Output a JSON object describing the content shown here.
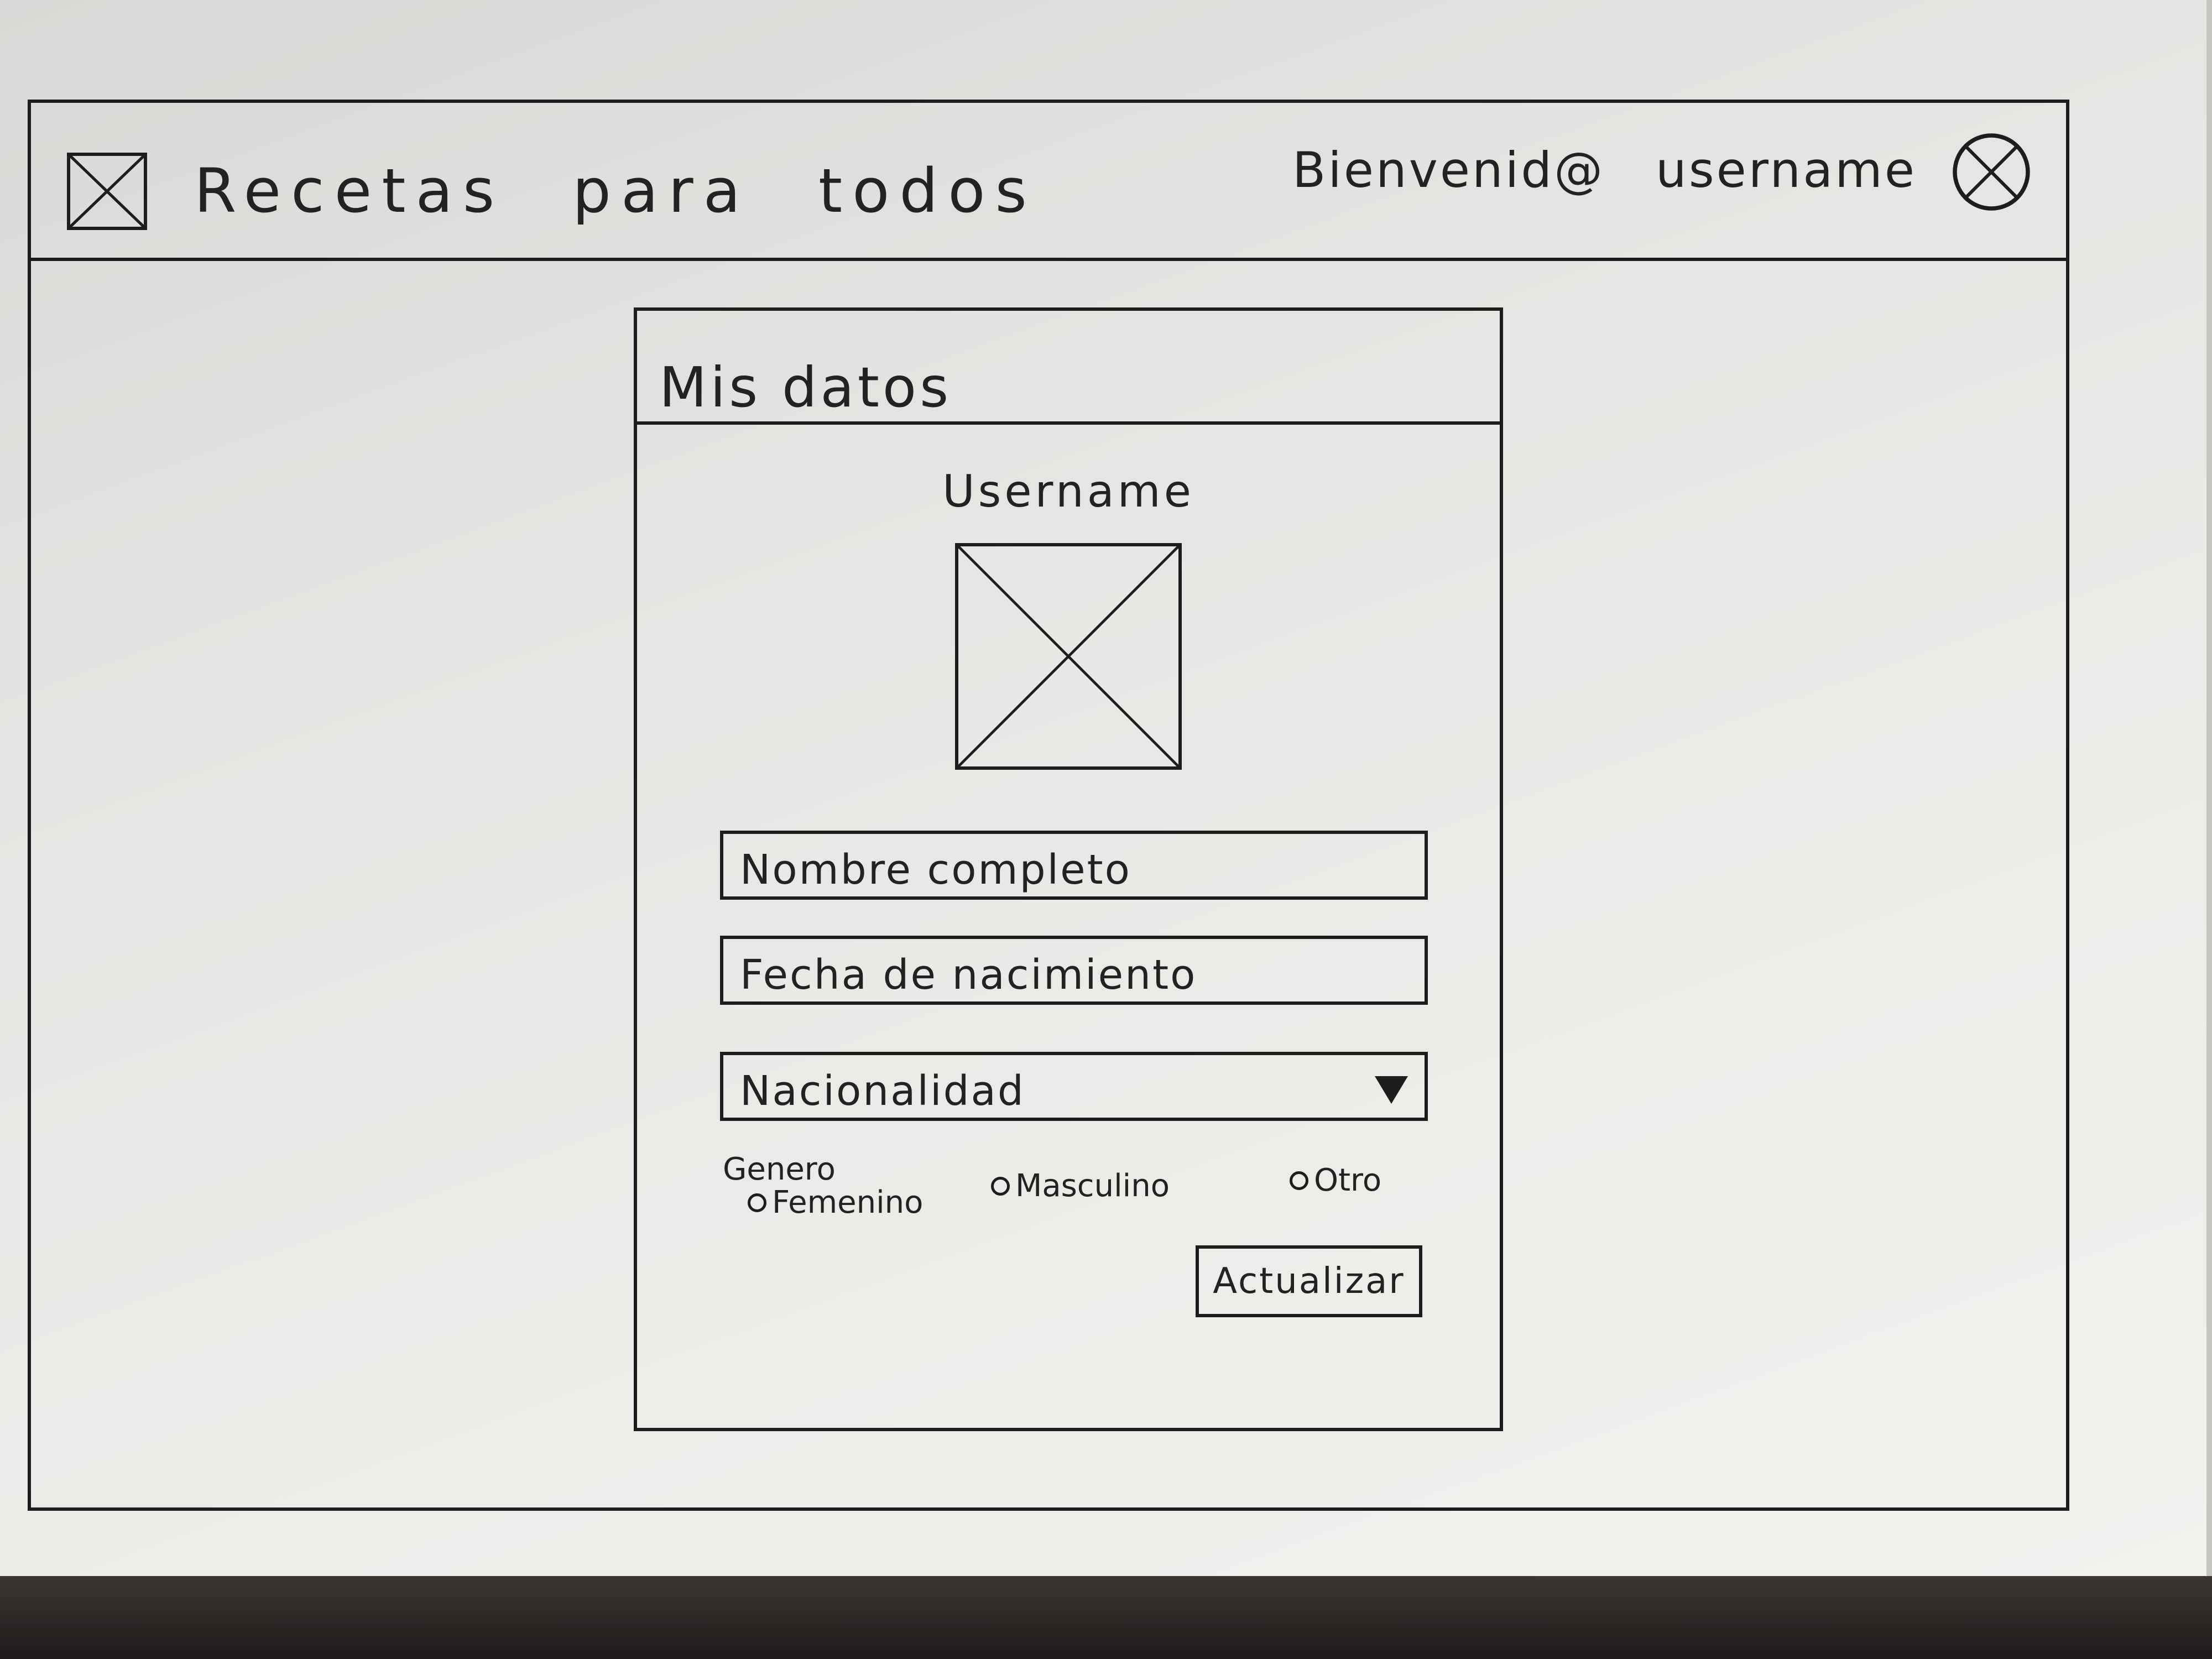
{
  "header": {
    "app_title": "Recetas para todos",
    "welcome_text": "Bienvenid@ username"
  },
  "card": {
    "title": "Mis datos",
    "username": "Username",
    "fields": {
      "nombre": "Nombre completo",
      "fecha": "Fecha de nacimiento",
      "nacionalidad": "Nacionalidad"
    },
    "genero": {
      "label": "Genero",
      "options": [
        "Femenino",
        "Masculino",
        "Otro"
      ]
    },
    "submit_label": "Actualizar"
  },
  "icons": {
    "logo": "image-placeholder-icon",
    "avatar": "user-avatar-icon",
    "profile_image": "image-placeholder-icon",
    "dropdown": "dropdown-triangle-icon"
  }
}
